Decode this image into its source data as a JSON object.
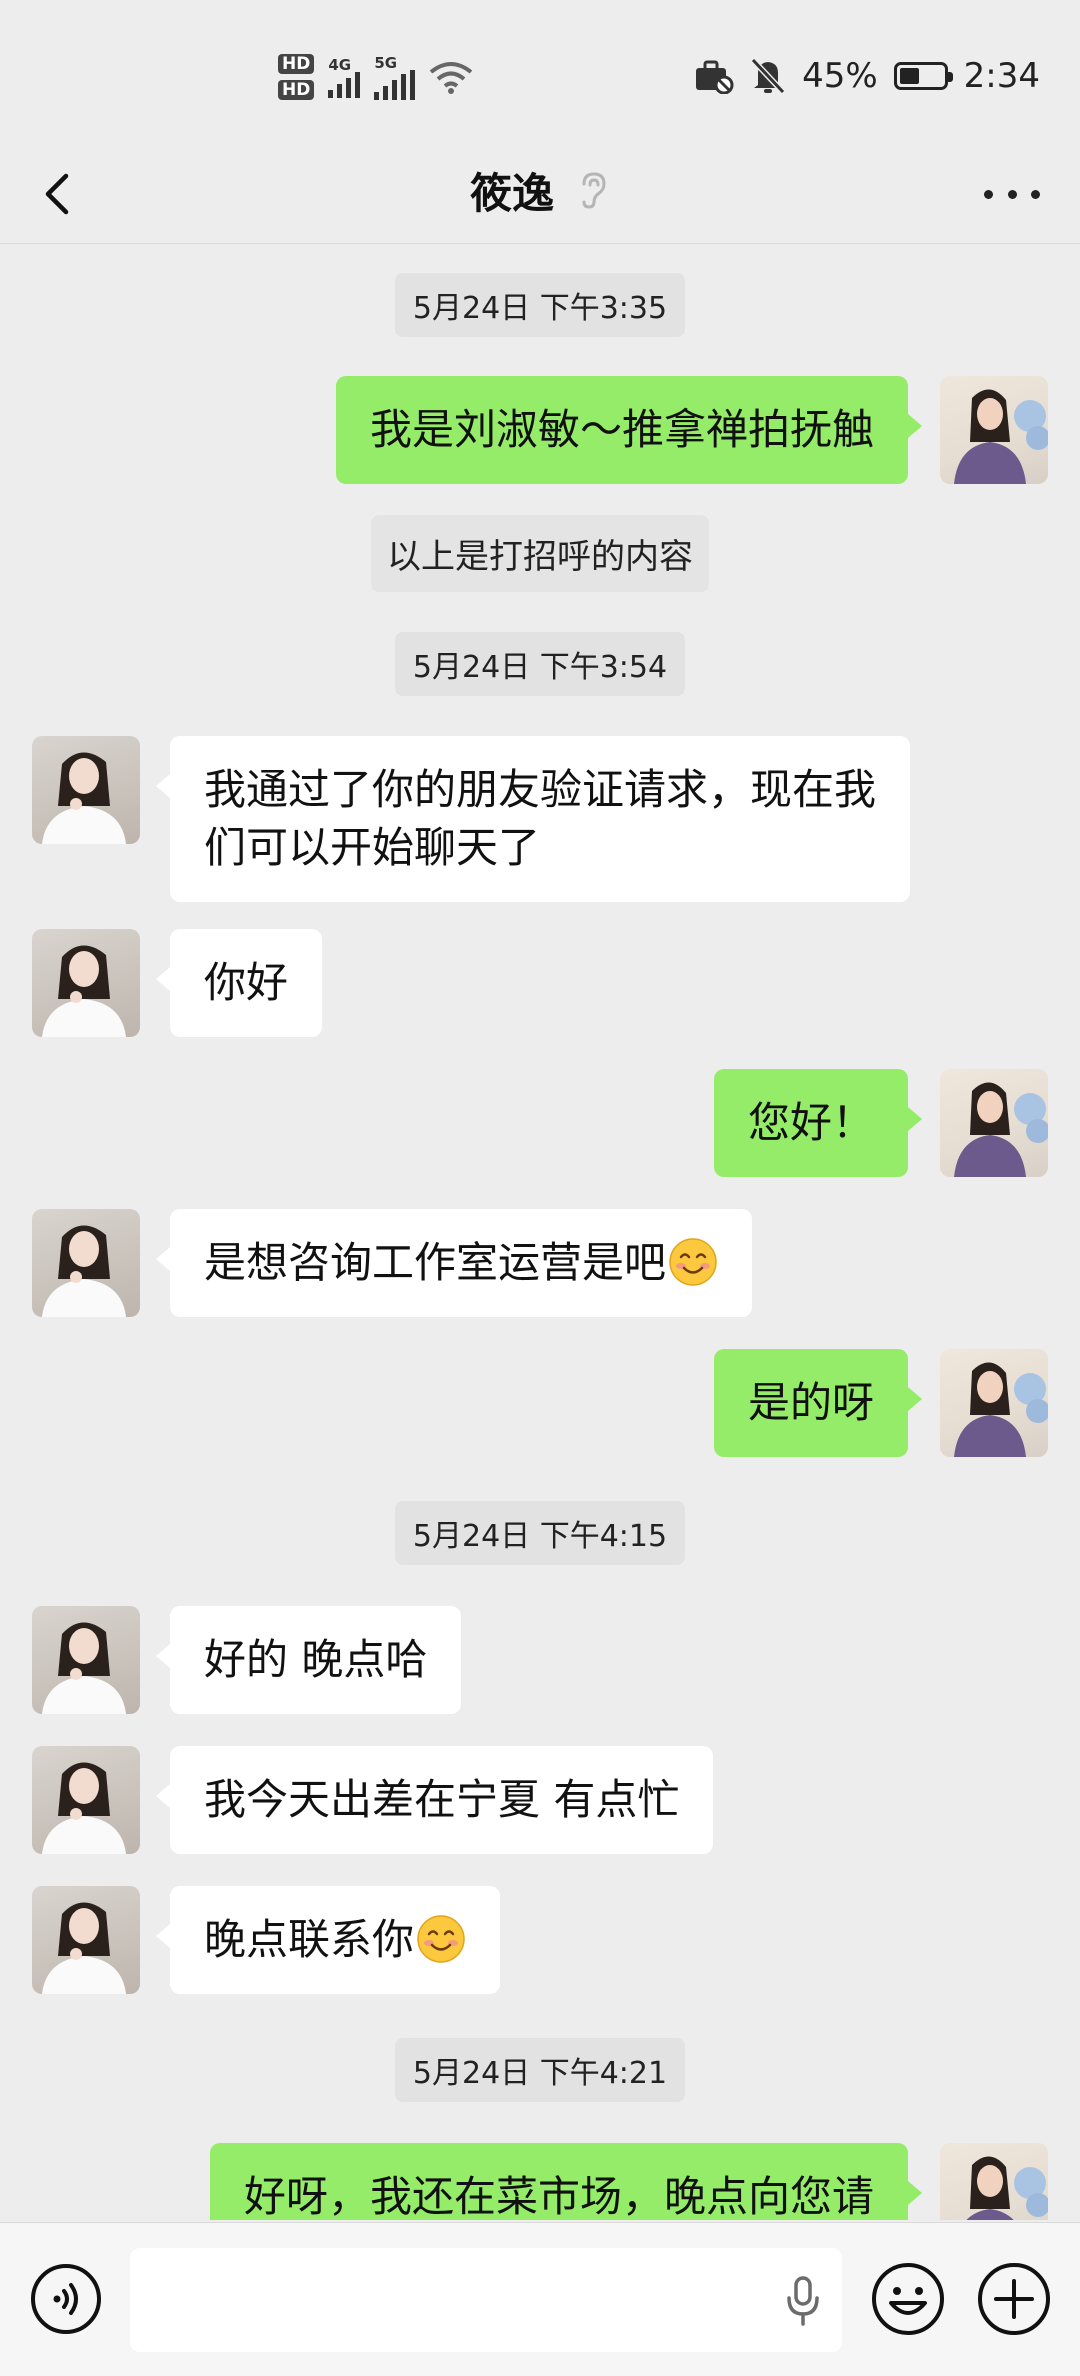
{
  "status_bar": {
    "hd1": "HD",
    "hd2": "HD",
    "net1": "4G",
    "net2": "5G",
    "battery_percent": "45%",
    "battery_level": 0.45,
    "time": "2:34"
  },
  "header": {
    "back_icon": "chevron-left-icon",
    "title": "筱逸",
    "ear_icon": "ear-icon",
    "more_icon": "more-dots-icon"
  },
  "chat": {
    "timestamps": [
      "5月24日 下午3:35",
      "5月24日 下午3:54",
      "5月24日 下午4:15",
      "5月24日 下午4:21"
    ],
    "system_notice": "以上是打招呼的内容",
    "messages": [
      {
        "sender": "me",
        "text": "我是刘淑敏～推拿禅拍抚触"
      },
      {
        "sender": "contact",
        "text": "我通过了你的朋友验证请求，现在我们可以开始聊天了"
      },
      {
        "sender": "contact",
        "text": "你好"
      },
      {
        "sender": "me",
        "text": "您好！"
      },
      {
        "sender": "contact",
        "text": "是想咨询工作室运营是吧",
        "emoji": "smile-emoji"
      },
      {
        "sender": "me",
        "text": "是的呀"
      },
      {
        "sender": "contact",
        "text": "好的 晚点哈"
      },
      {
        "sender": "contact",
        "text": "我今天出差在宁夏 有点忙"
      },
      {
        "sender": "contact",
        "text": "晚点联系你",
        "emoji": "smile-emoji"
      },
      {
        "sender": "me",
        "text": "好呀，我还在菜市场，晚点向您请"
      }
    ]
  },
  "input_bar": {
    "voice_icon": "voice-input-icon",
    "mic_icon": "microphone-icon",
    "emoji_icon": "emoji-icon",
    "plus_icon": "plus-icon",
    "input_value": ""
  },
  "colors": {
    "background": "#ededed",
    "outgoing_bubble": "#95ec69",
    "incoming_bubble": "#ffffff"
  }
}
